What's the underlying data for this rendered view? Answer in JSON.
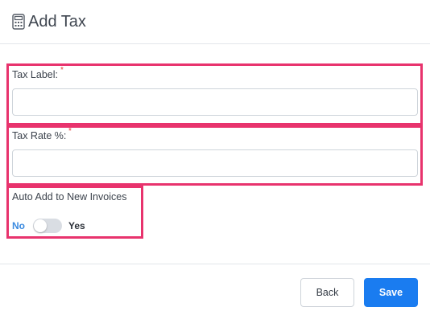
{
  "header": {
    "icon": "calculator-icon",
    "title": "Add Tax"
  },
  "form": {
    "tax_label": {
      "label": "Tax Label:",
      "required_mark": "*",
      "value": ""
    },
    "tax_rate": {
      "label": "Tax Rate %:",
      "required_mark": "*",
      "value": ""
    },
    "auto_add": {
      "label": "Auto Add to New Invoices",
      "off_label": "No",
      "on_label": "Yes",
      "value": "No"
    },
    "highlight_color": "#e8336d"
  },
  "footer": {
    "back_label": "Back",
    "save_label": "Save",
    "primary_color": "#1a7cf0"
  }
}
